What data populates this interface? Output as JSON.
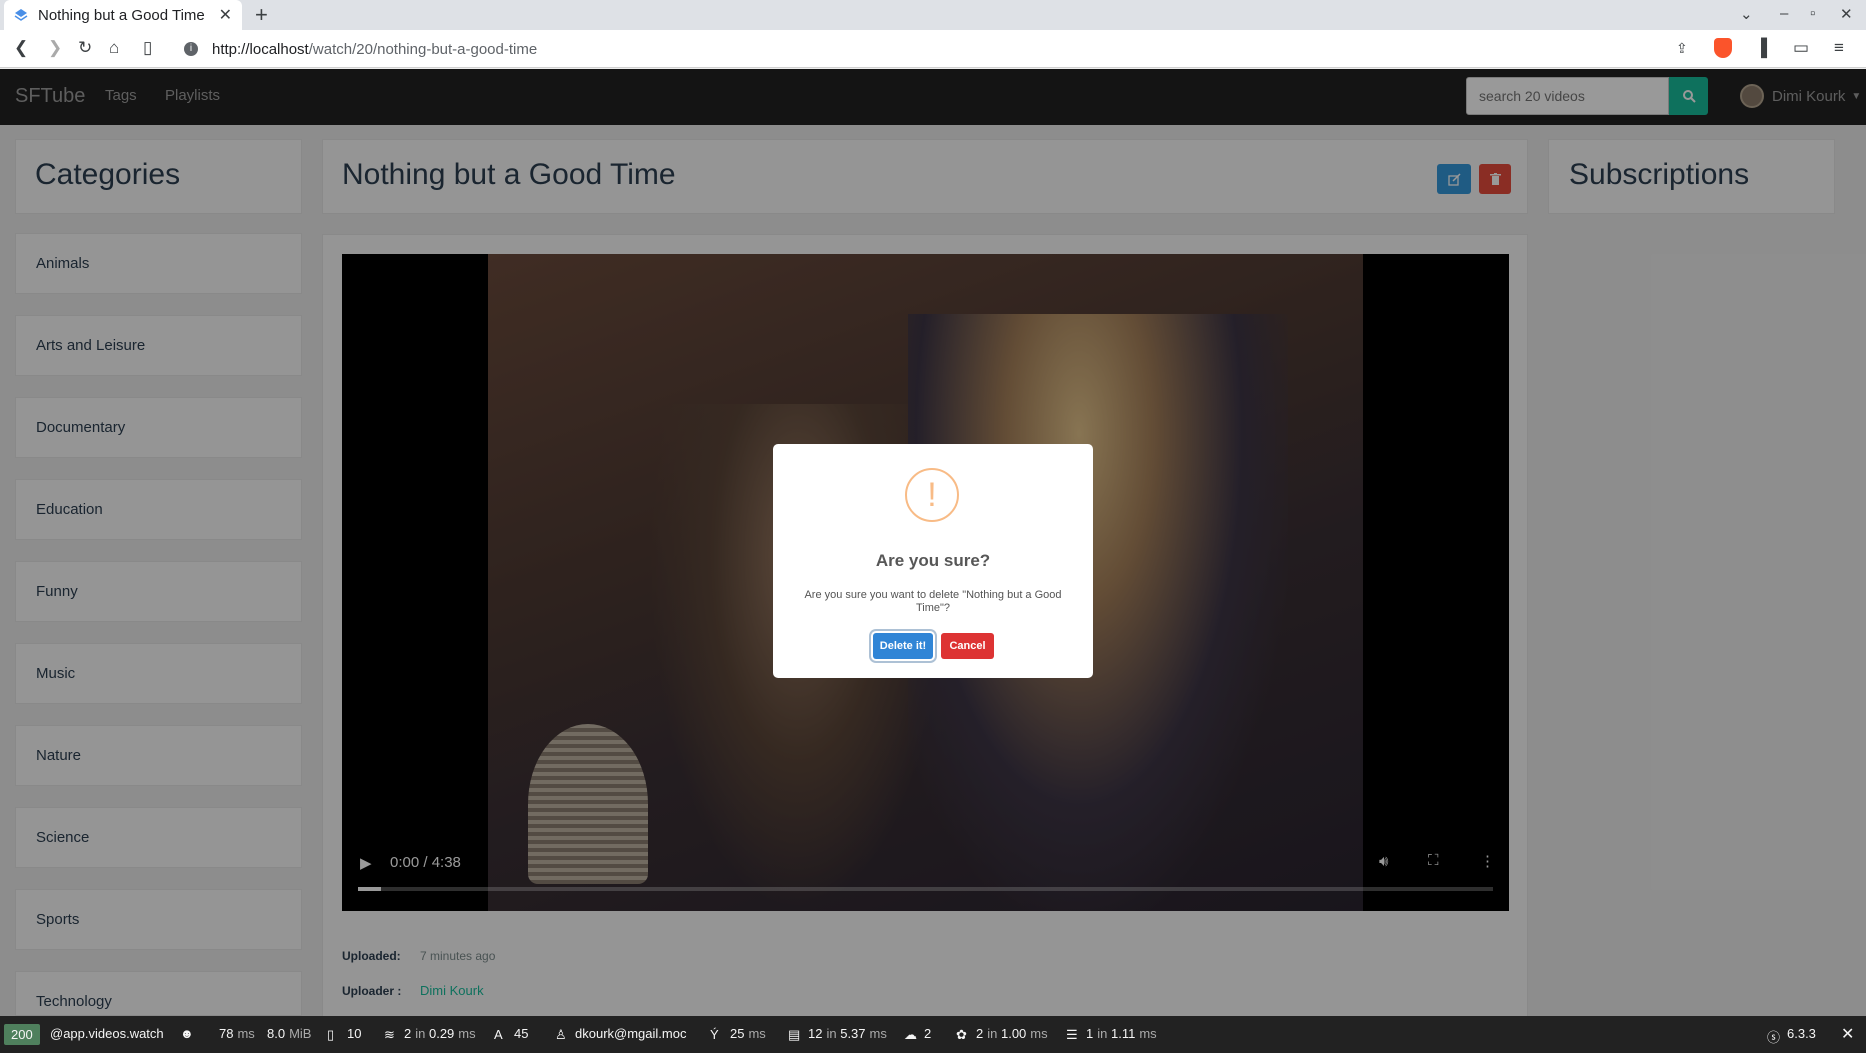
{
  "browser": {
    "tab_title": "Nothing but a Good Time",
    "url_host": "http://localhost",
    "url_path": "/watch/20/nothing-but-a-good-time"
  },
  "header": {
    "brand": "SFTube",
    "nav": [
      "Tags",
      "Playlists"
    ],
    "search_placeholder": "search 20 videos",
    "user_name": "Dimi Kourk"
  },
  "sidebar": {
    "title": "Categories",
    "items": [
      "Animals",
      "Arts and Leisure",
      "Documentary",
      "Education",
      "Funny",
      "Music",
      "Nature",
      "Science",
      "Sports",
      "Technology"
    ]
  },
  "video": {
    "title": "Nothing but a Good Time",
    "time": "0:00 / 4:38",
    "progress_fraction": 0.02,
    "uploaded_label": "Uploaded:",
    "uploaded_value": "7 minutes ago",
    "uploader_label": "Uploader :",
    "uploader_value": "Dimi Kourk"
  },
  "subscriptions": {
    "title": "Subscriptions"
  },
  "modal": {
    "icon": "!",
    "title": "Are you sure?",
    "text": "Are you sure you want to delete \"Nothing but a Good Time\"?",
    "confirm": "Delete it!",
    "cancel": "Cancel"
  },
  "toolbar": {
    "status": "200",
    "route": "@app.videos.watch",
    "time_value": "78",
    "time_unit": "ms",
    "memory": "8.0",
    "memory_unit": "MiB",
    "requests": "10",
    "cache_count": "2",
    "cache_in": "in",
    "cache_time": "0.29",
    "cache_unit": "ms",
    "translations": "45",
    "user": "dkourk@mgail.moc",
    "twig_time": "25",
    "twig_unit": "ms",
    "db_queries": "12",
    "db_in": "in",
    "db_time": "5.37",
    "db_unit": "ms",
    "http_calls": "2",
    "events_count": "2",
    "events_in": "in",
    "events_time": "1.00",
    "events_unit": "ms",
    "mail_count": "1",
    "mail_in": "in",
    "mail_time": "1.11",
    "mail_unit": "ms",
    "version": "6.3.3"
  },
  "colors": {
    "brand_green": "#18bc9c",
    "edit_blue": "#3498db",
    "delete_red": "#e74c3c",
    "modal_confirm": "#3085d6",
    "modal_cancel": "#dd3333",
    "warning_orange": "#f8bb86"
  }
}
